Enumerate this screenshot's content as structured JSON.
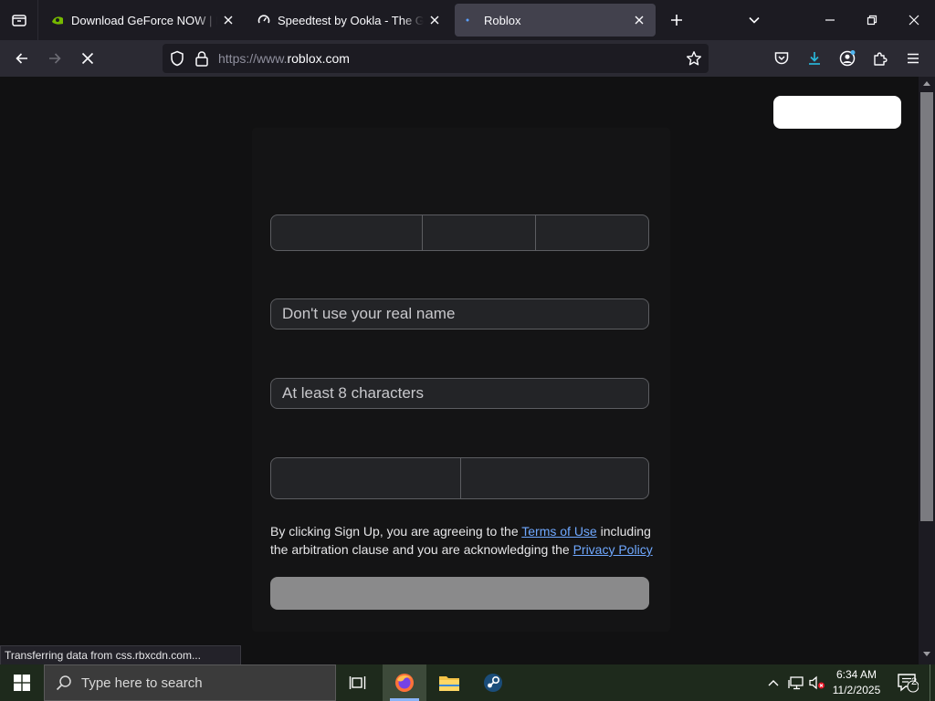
{
  "browser": {
    "tabs": [
      {
        "title": "Download GeForce NOW | NVIDIA",
        "active": false
      },
      {
        "title": "Speedtest by Ookla - The Global Broadband Speed Test",
        "active": false
      },
      {
        "title": "Roblox",
        "active": true
      }
    ],
    "url_prefix": "https://www.",
    "url_domain": "roblox.com",
    "status_text": "Transferring data from css.rbxcdn.com..."
  },
  "page": {
    "username_placeholder": "Don't use your real name",
    "password_placeholder": "At least 8 characters",
    "legal": {
      "before_terms": "By clicking Sign Up, you are agreeing to the ",
      "terms_link": "Terms of Use",
      "middle": " including the arbitration clause and you are acknowledging the ",
      "privacy_link": "Privacy Policy"
    }
  },
  "taskbar": {
    "search_placeholder": "Type here to search",
    "time": "6:34 AM",
    "date": "11/2/2025",
    "notification_count": "2"
  },
  "colors": {
    "link": "#6fa8ff",
    "active_tab": "#42414d",
    "download_accent": "#29b6d8",
    "nvidia_green": "#76b900"
  }
}
